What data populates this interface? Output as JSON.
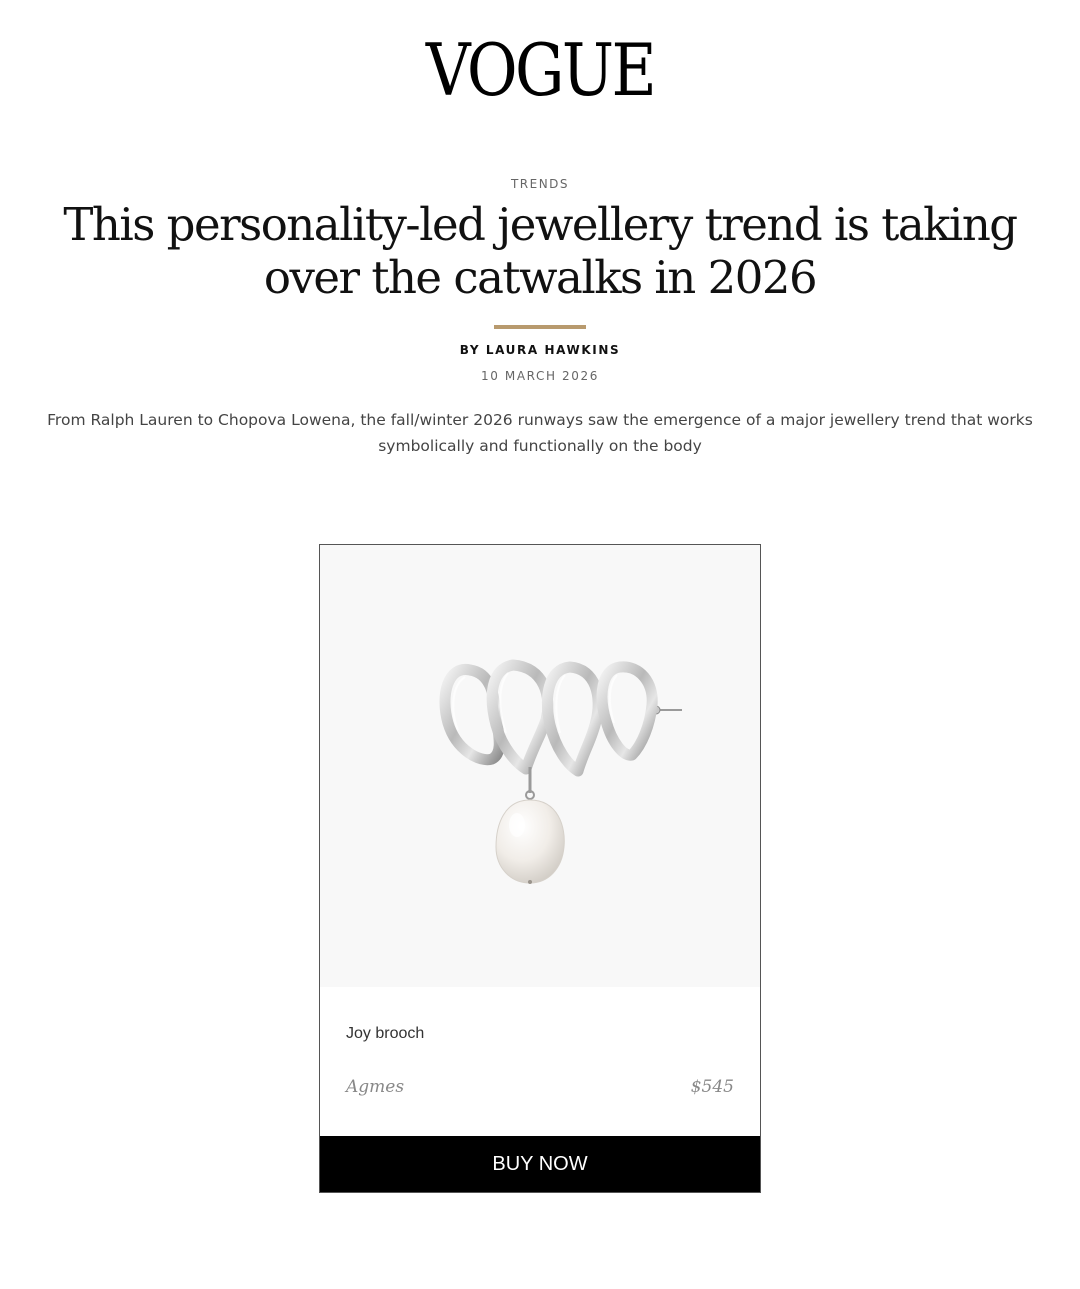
{
  "header": {
    "logo": "VOGUE"
  },
  "article": {
    "section": "TRENDS",
    "headline": "This personality-led jewellery trend is taking over the catwalks in 2026",
    "byline": "BY LAURA HAWKINS",
    "date": "10 MARCH 2026",
    "dek": "From Ralph Lauren to Chopova Lowena, the fall/winter 2026 runways saw the emergence of a major jewellery trend that works symbolically and functionally on the body"
  },
  "product": {
    "name": "Joy brooch",
    "brand": "Agmes",
    "price": "$545",
    "buy_label": "BUY NOW",
    "image_icon": "silver-brooch-with-pearl"
  },
  "colors": {
    "accent_rule": "#b89a6e",
    "button_bg": "#000000",
    "image_bg": "#f8f8f8"
  }
}
